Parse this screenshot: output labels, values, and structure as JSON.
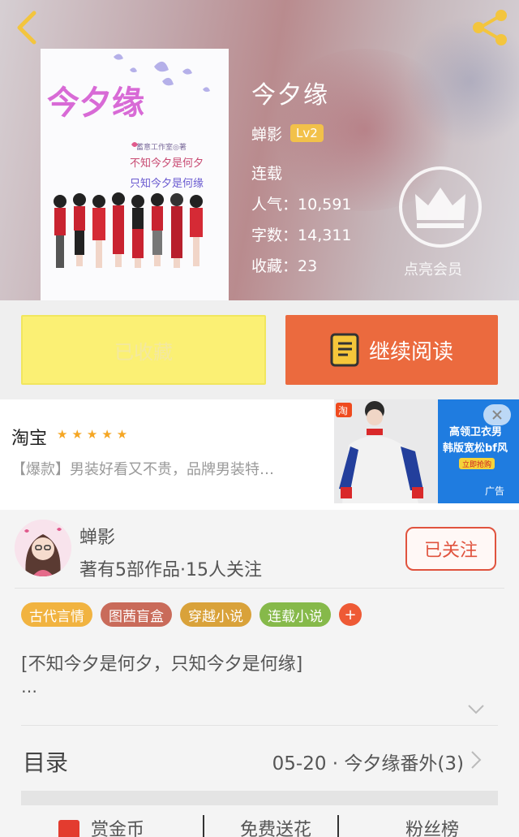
{
  "book": {
    "title": "今夕缘",
    "author": "蝉影",
    "level": "Lv2",
    "status": "连载",
    "popularity_label": "人气：",
    "popularity": "10,591",
    "words_label": "字数：",
    "words": "14,311",
    "favorites_label": "收藏：",
    "favorites": "23",
    "cover": {
      "title_art": "今夕缘",
      "small_credit": "蓄意工作室◎著",
      "line1": "不知今夕是何夕",
      "line2": "只知今夕是何缘"
    }
  },
  "vip": {
    "label": "点亮会员"
  },
  "actions": {
    "saved_label": "已收藏",
    "read_label": "继续阅读"
  },
  "ad": {
    "brand": "淘宝",
    "stars": "★★★★★",
    "description": "【爆款】男装好看又不贵，品牌男装特…",
    "image_line1": "高领卫衣男",
    "image_line2": "韩版宽松bf风",
    "image_cta": "立即抢购",
    "ad_tag": "广告",
    "logo_text": "淘"
  },
  "author_card": {
    "name": "蝉影",
    "stats": "著有5部作品·15人关注",
    "follow_label": "已关注"
  },
  "tags": [
    {
      "label": "古代言情",
      "color": "#f1b340"
    },
    {
      "label": "图茜盲盒",
      "color": "#c96b5a"
    },
    {
      "label": "穿越小说",
      "color": "#d9a23a"
    },
    {
      "label": "连载小说",
      "color": "#86b94a"
    }
  ],
  "tag_add": "+",
  "intro": {
    "text": "[不知今夕是何夕，只知今夕是何缘]",
    "more": "…"
  },
  "toc": {
    "label": "目录",
    "latest": "05-20 · 今夕缘番外(3)"
  },
  "bottom_row": {
    "item1": "赏金币",
    "item2": "免费送花",
    "item3": "粉丝榜"
  },
  "colors": {
    "accent": "#eb6a3e",
    "saved_bg": "#fbf074",
    "follow": "#e0533e",
    "vip_badge": "#f2c14a"
  }
}
